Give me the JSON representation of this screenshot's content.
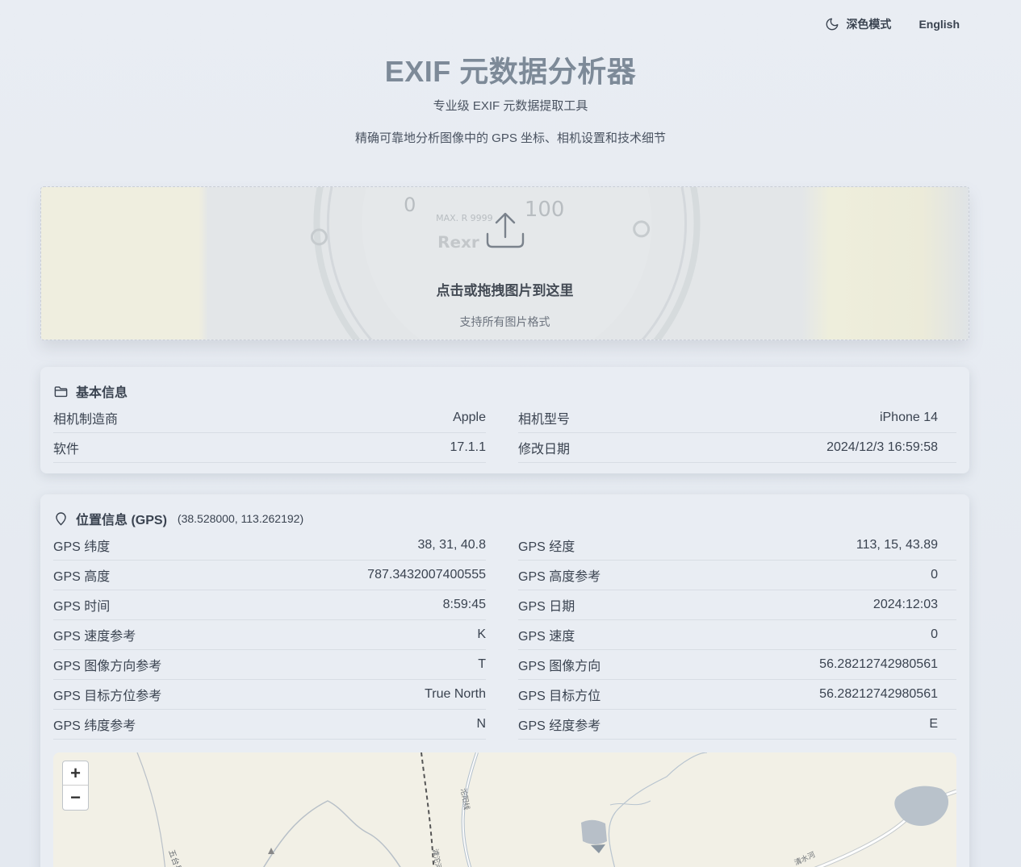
{
  "header": {
    "dark_mode_label": "深色模式",
    "language_label": "English",
    "title": "EXIF 元数据分析器",
    "subtitle": "专业级 EXIF 元数据提取工具",
    "description": "精确可靠地分析图像中的 GPS 坐标、相机设置和技术细节"
  },
  "upload": {
    "main_text": "点击或拖拽图片到这里",
    "sub_text": "支持所有图片格式"
  },
  "basic_info": {
    "title": "基本信息",
    "rows": [
      {
        "label": "相机制造商",
        "value": "Apple"
      },
      {
        "label": "相机型号",
        "value": "iPhone 14"
      },
      {
        "label": "软件",
        "value": "17.1.1"
      },
      {
        "label": "修改日期",
        "value": "2024/12/3 16:59:58"
      }
    ]
  },
  "gps_info": {
    "title": "位置信息 (GPS)",
    "coords": "(38.528000, 113.262192)",
    "rows": [
      {
        "label": "GPS 纬度",
        "value": "38, 31, 40.8"
      },
      {
        "label": "GPS 经度",
        "value": "113, 15, 43.89"
      },
      {
        "label": "GPS 高度",
        "value": "787.3432007400555"
      },
      {
        "label": "GPS 高度参考",
        "value": "0"
      },
      {
        "label": "GPS 时间",
        "value": "8:59:45"
      },
      {
        "label": "GPS 日期",
        "value": "2024:12:03"
      },
      {
        "label": "GPS 速度参考",
        "value": "K"
      },
      {
        "label": "GPS 速度",
        "value": "0"
      },
      {
        "label": "GPS 图像方向参考",
        "value": "T"
      },
      {
        "label": "GPS 图像方向",
        "value": "56.28212742980561"
      },
      {
        "label": "GPS 目标方位参考",
        "value": "True North"
      },
      {
        "label": "GPS 目标方位",
        "value": "56.28212742980561"
      },
      {
        "label": "GPS 纬度参考",
        "value": "N"
      },
      {
        "label": "GPS 经度参考",
        "value": "E"
      }
    ]
  },
  "map": {
    "zoom_in": "+",
    "zoom_out": "−",
    "labels": [
      "五台县",
      "沱阳线",
      "滹沱河",
      "清水河"
    ]
  }
}
